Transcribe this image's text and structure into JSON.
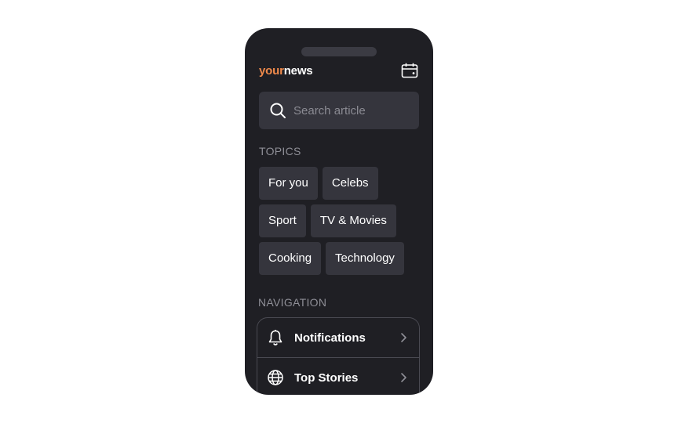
{
  "app": {
    "logo_your": "your",
    "logo_news": "news",
    "calendar_icon": "calendar-icon"
  },
  "search": {
    "placeholder": "Search article",
    "value": "",
    "icon": "search-icon"
  },
  "topics": {
    "label": "TOPICS",
    "items": [
      {
        "label": "For you"
      },
      {
        "label": "Celebs"
      },
      {
        "label": "Sport"
      },
      {
        "label": "TV & Movies"
      },
      {
        "label": "Cooking"
      },
      {
        "label": "Technology"
      }
    ]
  },
  "navigation": {
    "label": "NAVIGATION",
    "items": [
      {
        "label": "Notifications",
        "icon": "bell-icon"
      },
      {
        "label": "Top Stories",
        "icon": "globe-icon"
      }
    ]
  },
  "colors": {
    "background": "#1f1f24",
    "accent": "#f08a4b",
    "chip": "#35353d"
  }
}
